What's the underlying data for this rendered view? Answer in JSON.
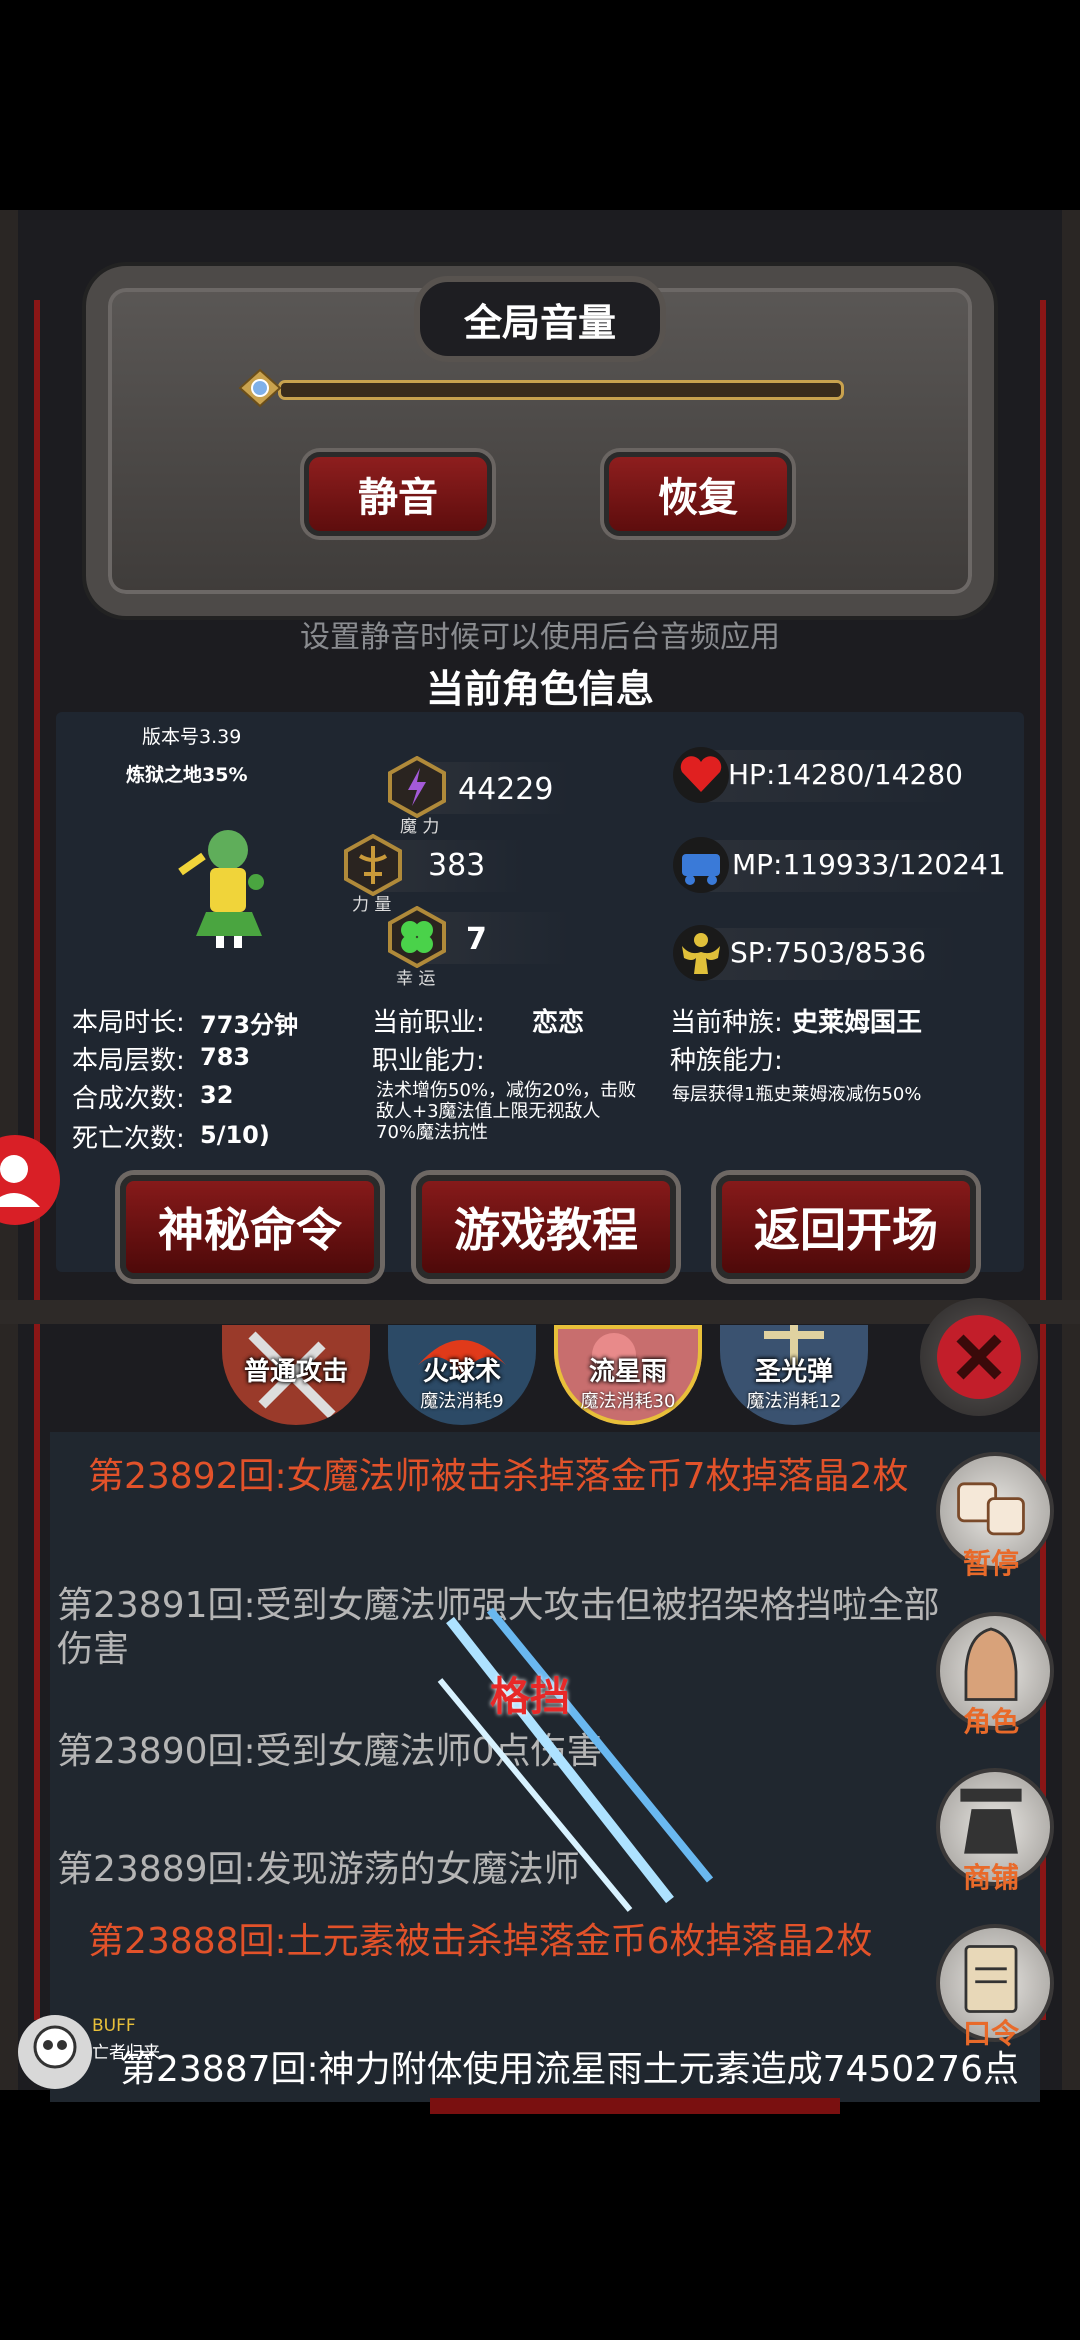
{
  "volume": {
    "title": "全局音量",
    "mute_label": "静音",
    "restore_label": "恢复",
    "hint": "设置静音时候可以使用后台音频应用",
    "level": 1.0
  },
  "character": {
    "title": "当前角色信息",
    "version": "版本号3.39",
    "location": "炼狱之地35%",
    "magic": {
      "value": "44229",
      "label": "魔 力"
    },
    "strength": {
      "value": "383",
      "label": "力 量"
    },
    "luck": {
      "value": "7",
      "label": "幸 运"
    },
    "hp": "HP:14280/14280",
    "mp": "MP:119933/120241",
    "sp": "SP:7503/8536",
    "duration_label": "本局时长:",
    "duration_value": "773分钟",
    "floors_label": "本局层数:",
    "floors_value": "783",
    "synth_label": "合成次数:",
    "synth_value": "32",
    "death_label": "死亡次数:",
    "death_value": "5/10)",
    "job_label": "当前职业:",
    "job_value": "恋恋",
    "job_ability_label": "职业能力:",
    "job_ability_desc": "法术增伤50%，减伤20%，击败敌人+3魔法值上限无视敌人70%魔法抗性",
    "race_label": "当前种族:",
    "race_value": "史莱姆国王",
    "race_ability_label": "种族能力:",
    "race_ability_desc": "每层获得1瓶史莱姆液减伤50%"
  },
  "commands": {
    "secret": "神秘命令",
    "tutorial": "游戏教程",
    "back": "返回开场"
  },
  "skills": [
    {
      "name": "普通攻击",
      "cost": ""
    },
    {
      "name": "火球术",
      "cost": "魔法消耗9"
    },
    {
      "name": "流星雨",
      "cost": "魔法消耗30"
    },
    {
      "name": "圣光弹",
      "cost": "魔法消耗12"
    }
  ],
  "log": [
    "第23892回:女魔法师被击杀掉落金币7枚掉落晶2枚",
    "第23891回:受到女魔法师强大攻击但被招架格挡啦全部伤害",
    "第23890回:受到女魔法师0点伤害",
    "第23889回:发现游荡的女魔法师",
    "第23888回:土元素被击杀掉落金币6枚掉落晶2枚",
    "第23887回:神力附体使用流星雨土元素造成7450276点"
  ],
  "parry_text": "格挡",
  "side_menu": {
    "pause": "暂停",
    "character": "角色",
    "shop": "商铺",
    "password": "口令"
  },
  "buff": {
    "label": "BUFF",
    "sub": "亡者归来"
  },
  "colors": {
    "kill_log": "#e2522a",
    "info_log": "#b5b5b5",
    "accent_red": "#8e1e1e",
    "side_label": "#e86a2a"
  }
}
